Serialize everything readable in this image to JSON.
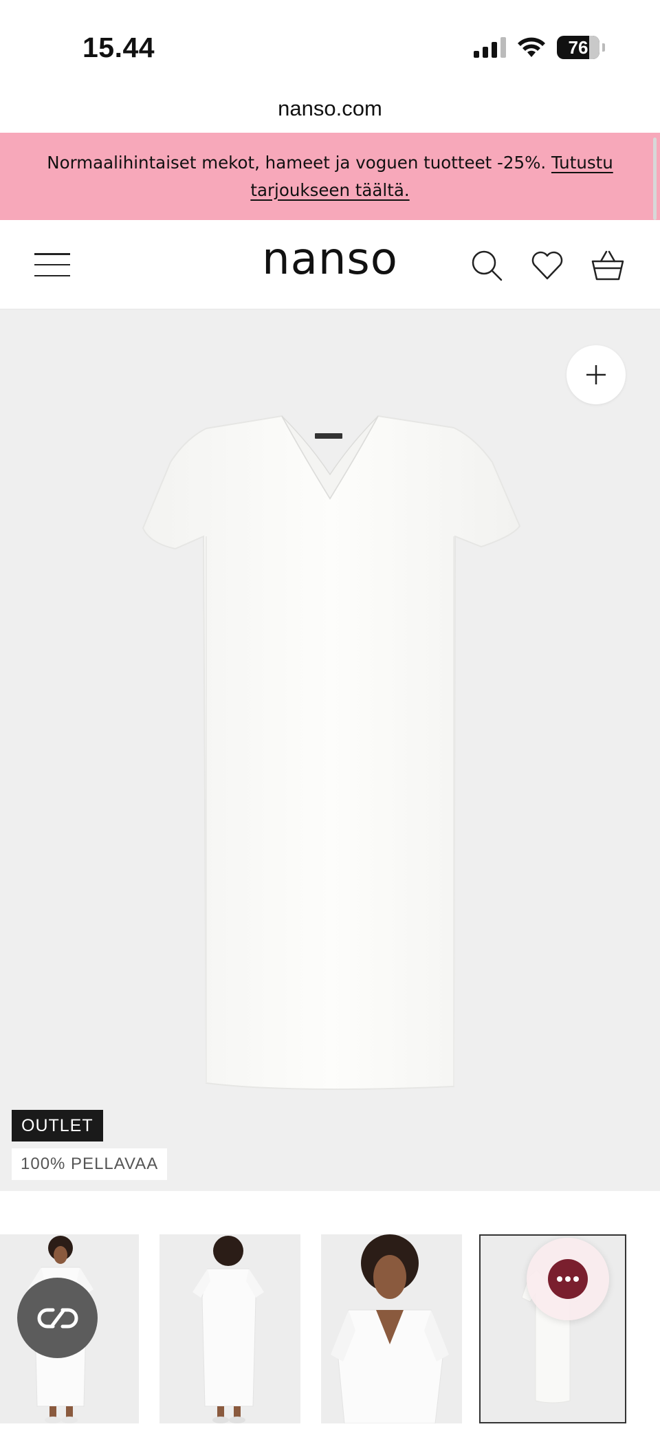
{
  "status_bar": {
    "time": "15.44",
    "battery": "76",
    "battery_level": 0.76
  },
  "browser": {
    "url": "nanso.com"
  },
  "promo": {
    "text": "Normaalihintaiset mekot, hameet ja voguen tuotteet -25%.",
    "link_text": "Tutustu tarjoukseen täältä.",
    "bg_color": "#f7a8ba"
  },
  "header": {
    "logo": "nanso",
    "icons": [
      "menu-icon",
      "search-icon",
      "heart-icon",
      "basket-icon"
    ]
  },
  "product": {
    "badges": {
      "outlet": "OUTLET",
      "material": "100% PELLAVAA"
    },
    "gallery_bg": "#efefef",
    "thumbnails": [
      "front-model",
      "back-model",
      "closeup-model",
      "flat-product"
    ],
    "selected_thumbnail": 4
  },
  "widgets": {
    "chat_color": "#7a1f2e",
    "left_fab_color": "#5c5c5c"
  }
}
